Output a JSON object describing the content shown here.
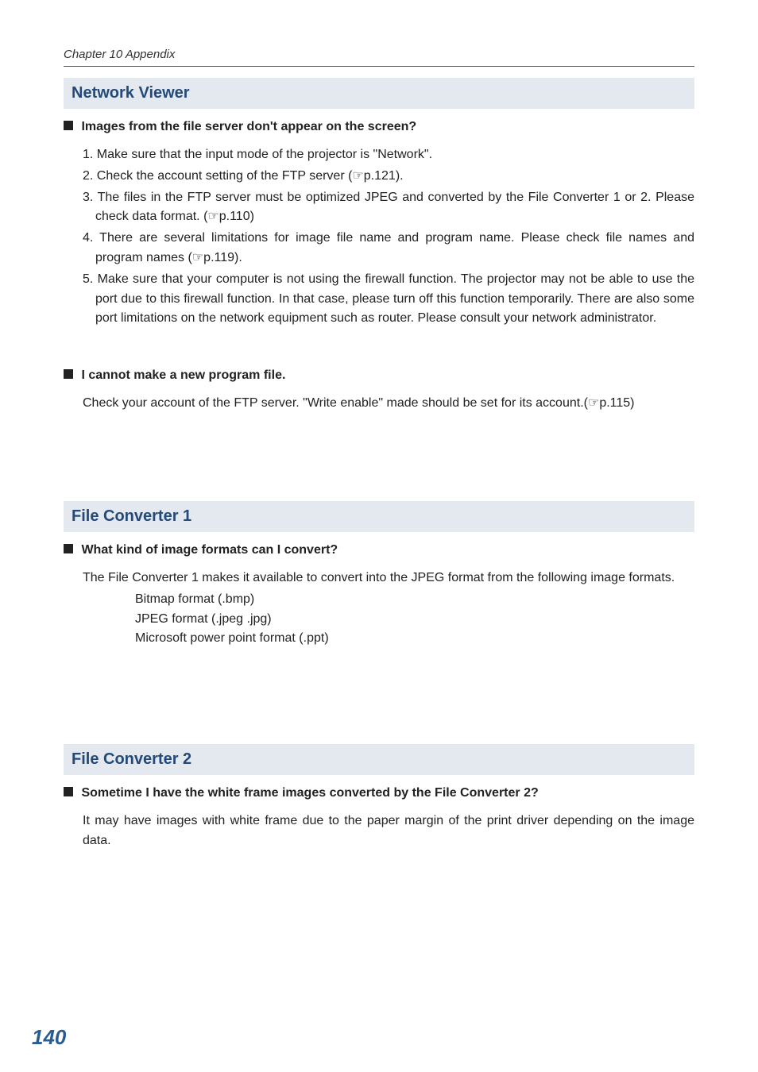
{
  "chapter_header": "Chapter 10 Appendix",
  "page_number": "140",
  "pointer_glyph": "☞",
  "sections": {
    "network_viewer": {
      "title": "Network Viewer",
      "q1": {
        "heading": "Images from the file server don't appear on the screen?",
        "items": {
          "i1": {
            "num": "1.",
            "text": " Make sure that the input mode of the projector is \"Network\"."
          },
          "i2": {
            "num": "2.",
            "pre": " Check the account setting of the FTP server (",
            "ref": "p.121",
            "post": ")."
          },
          "i3": {
            "num": "3.",
            "pre": " The files in the FTP server must be optimized JPEG and converted  by the File Converter 1 or 2. Please check data format. (",
            "ref": "p.110",
            "post": ")"
          },
          "i4": {
            "num": "4.",
            "pre": " There are several limitations for image file name and program name. Please check file names and program names (",
            "ref": "p.119",
            "post": ")."
          },
          "i5": {
            "num": "5.",
            "text": " Make sure that your computer is not using the firewall function. The projector may not be able to use the port due to this firewall function. In that case, please turn off this function temporarily. There are also some port limitations on the network equipment such as router. Please consult your network administrator."
          }
        }
      },
      "q2": {
        "heading": "I cannot make a new program file.",
        "para_pre": "Check your account of the FTP server. \"Write enable\"  made should be set for its account.(",
        "para_ref": "p.115",
        "para_post": ")"
      }
    },
    "file_converter_1": {
      "title": "File Converter 1",
      "q1": {
        "heading": "What kind of image formats can I convert?",
        "para": "The File Converter 1 makes it available to convert into the JPEG format from the following image formats.",
        "formats": {
          "f1": "Bitmap format (.bmp)",
          "f2": "JPEG format (.jpeg .jpg)",
          "f3": "Microsoft power point format (.ppt)"
        }
      }
    },
    "file_converter_2": {
      "title": "File Converter 2",
      "q1": {
        "heading": "Sometime I have the white frame images converted by the File Converter 2?",
        "para": "It may have images with white frame due to the paper margin of the print driver depending on the image data."
      }
    }
  }
}
